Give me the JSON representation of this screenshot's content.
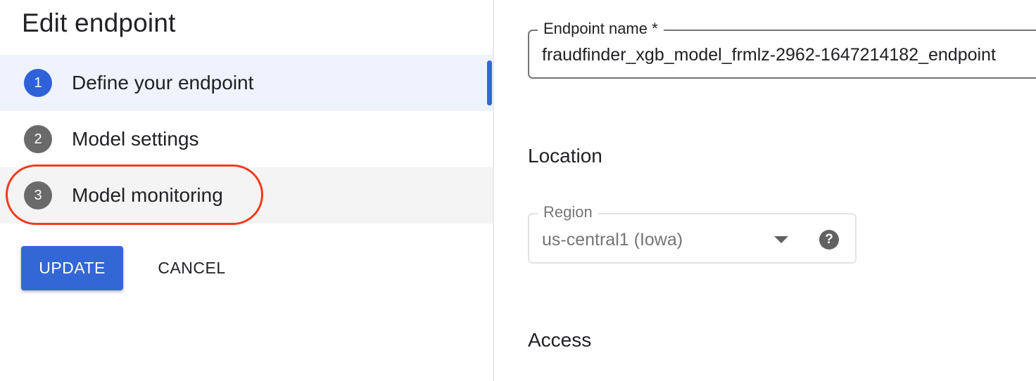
{
  "header": {
    "title": "Edit endpoint"
  },
  "steps": [
    {
      "number": "1",
      "label": "Define your endpoint"
    },
    {
      "number": "2",
      "label": "Model settings"
    },
    {
      "number": "3",
      "label": "Model monitoring"
    }
  ],
  "actions": {
    "update_label": "UPDATE",
    "cancel_label": "CANCEL"
  },
  "form": {
    "endpoint_name": {
      "label": "Endpoint name *",
      "value": "fraudfinder_xgb_model_frmlz-2962-1647214182_endpoint"
    },
    "location_heading": "Location",
    "region": {
      "label": "Region",
      "value": "us-central1 (Iowa)",
      "help_icon": "?"
    },
    "access_heading": "Access"
  },
  "colors": {
    "accent": "#3367d6",
    "active_step_bg": "#eef3fd",
    "highlight_circle": "#f23a1e"
  }
}
